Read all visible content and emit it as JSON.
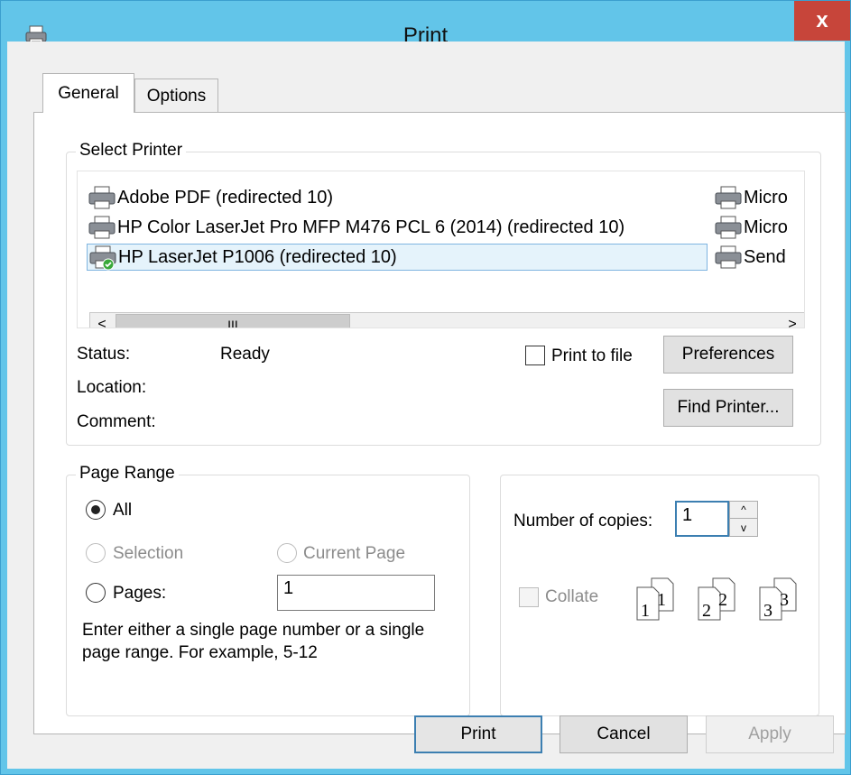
{
  "window": {
    "title": "Print",
    "close_label": "x"
  },
  "tabs": [
    {
      "label": "General",
      "active": true
    },
    {
      "label": "Options",
      "active": false
    }
  ],
  "select_printer": {
    "legend": "Select Printer",
    "printers_col1": [
      {
        "name": "Adobe PDF (redirected 10)",
        "icon": "printer-icon",
        "selected": false
      },
      {
        "name": "HP Color LaserJet Pro MFP M476 PCL 6 (2014) (redirected 10)",
        "icon": "printer-icon",
        "selected": false
      },
      {
        "name": "HP LaserJet P1006 (redirected 10)",
        "icon": "default-printer-icon",
        "selected": true
      }
    ],
    "printers_col2": [
      {
        "name": "Micro",
        "icon": "printer-icon"
      },
      {
        "name": "Micro",
        "icon": "printer-icon"
      },
      {
        "name": "Send",
        "icon": "printer-icon"
      }
    ],
    "scroll_left": "<",
    "scroll_right": ">",
    "scroll_thumb": "III",
    "status_label": "Status:",
    "status_value": "Ready",
    "location_label": "Location:",
    "comment_label": "Comment:",
    "print_to_file_label": "Print to file",
    "preferences_label": "Preferences",
    "find_printer_label": "Find Printer..."
  },
  "page_range": {
    "legend": "Page Range",
    "all_label": "All",
    "selection_label": "Selection",
    "current_page_label": "Current Page",
    "pages_label": "Pages:",
    "pages_value": "1",
    "help_line1": "Enter either a single page number or a single",
    "help_line2": "page range.  For example, 5-12"
  },
  "copies": {
    "label": "Number of copies:",
    "value": "1",
    "spin_up": "^",
    "spin_down": "v",
    "collate_label": "Collate",
    "collate_page_numbers": [
      "1",
      "1",
      "2",
      "2",
      "3",
      "3"
    ]
  },
  "footer": {
    "print_label": "Print",
    "cancel_label": "Cancel",
    "apply_label": "Apply"
  },
  "colors": {
    "titlebar": "#62c5e9",
    "close_button": "#c7453a",
    "selection_highlight": "#e5f3fb",
    "default_button_border": "#3c7fb1"
  }
}
